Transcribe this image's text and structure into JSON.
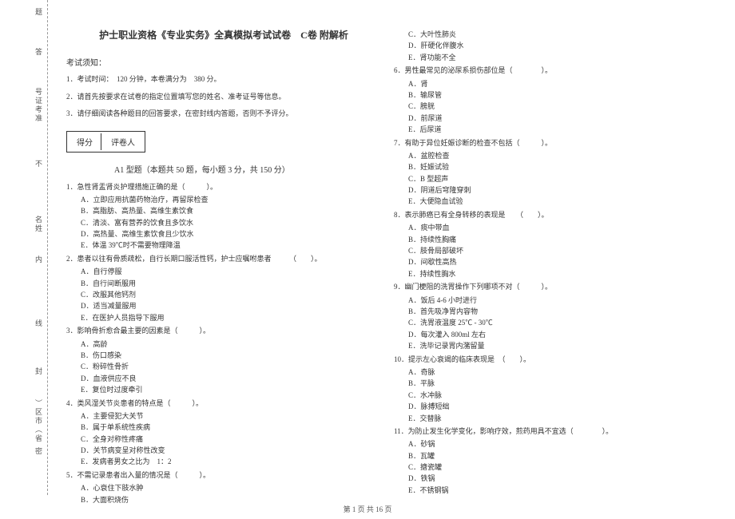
{
  "margin": {
    "v1": "题",
    "v2": "答",
    "v3": "号证考准",
    "v4": "不",
    "v5": "名姓",
    "v6": "内",
    "v7": "线",
    "v8": "封",
    "v9": "）区市（省",
    "v10": "密"
  },
  "title": "护士职业资格《专业实务》全真模拟考试试卷　C卷  附解析",
  "notice_head": "考试须知：",
  "notice1": "1．考试时间：　120 分钟，本卷满分为　380 分。",
  "notice2": "2．请首先按要求在试卷的指定位置填写您的姓名、准考证号等信息。",
  "notice3": "3．请仔细阅读各种题目的回答要求，在密封线内答题，否则不予评分。",
  "score": {
    "c1": "得分",
    "c2": "评卷人"
  },
  "type_title": "A1  型题（本题共  50 题，每小题  3 分，共  150 分）",
  "q1": {
    "stem": "1．急性肾盂肾炎护理措施正确的是（　　　）。",
    "a": "A．立即应用抗菌药物治疗，再留尿检查",
    "b": "B．高脂肪、高热量、高维生素饮食",
    "c": "C．清淡、富有营养的饮食且多饮水",
    "d": "D．高热量、高维生素饮食且少饮水",
    "e": "E．体温 39℃时不需要物理降温"
  },
  "q2": {
    "stem": "2．患者以往有骨质疏松，自行长期口服活性钙，护士应嘱咐患者　　　（　　）。",
    "a": "A．自行停服",
    "b": "B．自行间断服用",
    "c": "C．改服其他钙剂",
    "d": "D．适当减量服用",
    "e": "E．在医护人员指导下服用"
  },
  "q3": {
    "stem": "3．影响骨折愈合最主要的因素是（　　　）。",
    "a": "A．高龄",
    "b": "B．伤口感染",
    "c": "C．粉碎性骨折",
    "d": "D．血液供应不良",
    "e": "E．复位时过度牵引"
  },
  "q4": {
    "stem": "4．类风湿关节炎患者的特点是（　　　）。",
    "a": "A．主要侵犯大关节",
    "b": "B．属于单系统性疾病",
    "c": "C．全身对称性疼痛",
    "d": "D．关节病变呈对称性改变",
    "e": "E．发病者男女之比为　1：2"
  },
  "q5": {
    "stem": "5．不需记录患者出入量的情况是（　　　）。",
    "a": "A．心衰住下肢水肿",
    "b": "B．大面积烧伤"
  },
  "q5r": {
    "c": "C．大叶性肺炎",
    "d": "D．肝硬化伴腹水",
    "e": "E．肾功能不全"
  },
  "q6": {
    "stem": "6．男性最常见的泌尿系损伤部位是（　　　　）。",
    "a": "A．肾",
    "b": "B．输尿管",
    "c": "C．膀胱",
    "d": "D．前尿道",
    "e": "E．后尿道"
  },
  "q7": {
    "stem": "7．有助于异位妊娠诊断的检查不包括（　　　）。",
    "a": "A．盆腔检查",
    "b": "B．妊娠试验",
    "c": "C．B 型超声",
    "d": "D．阴道后穹隆穿刺",
    "e": "E．大便隐血试验"
  },
  "q8": {
    "stem": "8．表示肺癌已有全身转移的表现是　　（　　）。",
    "a": "A．痰中带血",
    "b": "B．持续性胸痛",
    "c": "C．肢骨局部破坏",
    "d": "D．间歇性高热",
    "e": "E．持续性胸水"
  },
  "q9": {
    "stem": "9．幽门梗阻的洗胃操作下列哪项不对（　　　）。",
    "a": "A．饭后 4-6 小时进行",
    "b": "B．首先吸净胃内容物",
    "c": "C．洗胃液温度 25℃ - 30℃",
    "d": "D．每次灌入  800ml 左右",
    "e": "E．洗毕记录胃内潴留量"
  },
  "q10": {
    "stem": "10．提示左心衰竭的临床表现是　（　　）。",
    "a": "A．奇脉",
    "b": "B．平脉",
    "c": "C．水冲脉",
    "d": "D．脉搏短绌",
    "e": "E．交替脉"
  },
  "q11": {
    "stem": "11．为防止发生化学变化，影响疗效，煎药用具不宜选（　　　　）。",
    "a": "A．砂锅",
    "b": "B．瓦罐",
    "c": "C．搪瓷罐",
    "d": "D．铁锅",
    "e": "E．不锈钢锅"
  },
  "footer": "第  1 页 共 16 页"
}
